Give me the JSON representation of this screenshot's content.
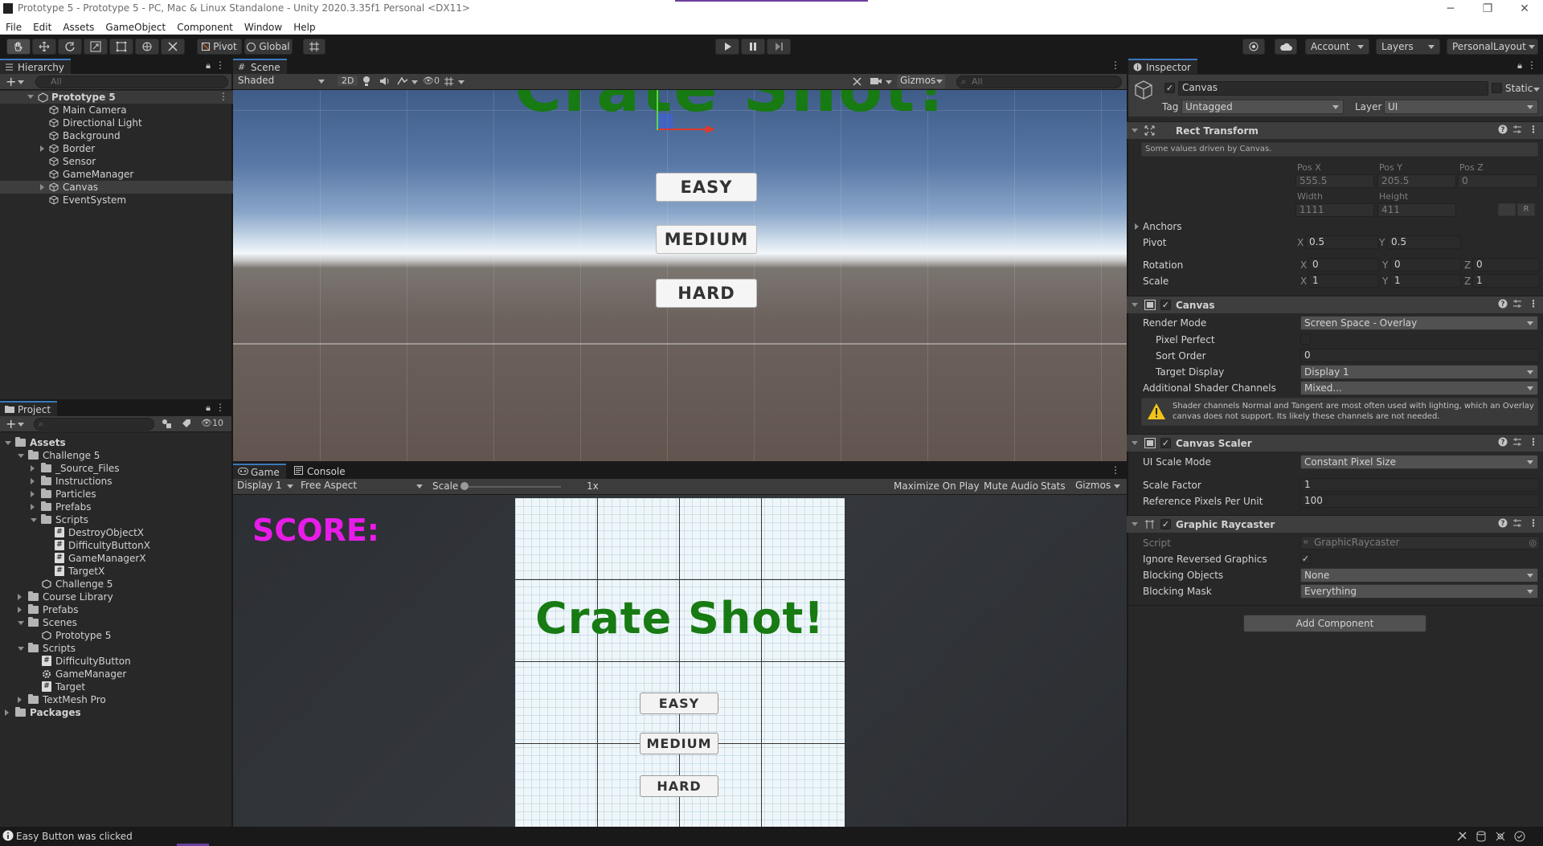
{
  "window": {
    "title": "Prototype 5 - Prototype 5 - PC, Mac & Linux Standalone - Unity 2020.3.35f1 Personal <DX11>",
    "minimize": "─",
    "restore": "❐",
    "close": "✕"
  },
  "menu": [
    "File",
    "Edit",
    "Assets",
    "GameObject",
    "Component",
    "Window",
    "Help"
  ],
  "toolbar": {
    "pivot": "Pivot",
    "global": "Global",
    "account": "Account",
    "layers": "Layers",
    "layout": "PersonalLayout"
  },
  "hierarchy": {
    "tab": "Hierarchy",
    "search_placeholder": "All",
    "scene": "Prototype 5",
    "items": [
      {
        "label": "Main Camera"
      },
      {
        "label": "Directional Light"
      },
      {
        "label": "Background"
      },
      {
        "label": "Border"
      },
      {
        "label": "Sensor"
      },
      {
        "label": "GameManager"
      },
      {
        "label": "Canvas"
      },
      {
        "label": "EventSystem"
      }
    ]
  },
  "project": {
    "tab": "Project",
    "count": "10",
    "items": [
      {
        "label": "Assets"
      },
      {
        "label": "Challenge 5"
      },
      {
        "label": "_Source_Files"
      },
      {
        "label": "Instructions"
      },
      {
        "label": "Particles"
      },
      {
        "label": "Prefabs"
      },
      {
        "label": "Scripts"
      },
      {
        "label": "DestroyObjectX"
      },
      {
        "label": "DifficultyButtonX"
      },
      {
        "label": "GameManagerX"
      },
      {
        "label": "TargetX"
      },
      {
        "label": "Challenge 5"
      },
      {
        "label": "Course Library"
      },
      {
        "label": "Prefabs"
      },
      {
        "label": "Scenes"
      },
      {
        "label": "Prototype 5"
      },
      {
        "label": "Scripts"
      },
      {
        "label": "DifficultyButton"
      },
      {
        "label": "GameManager"
      },
      {
        "label": "Target"
      },
      {
        "label": "TextMesh Pro"
      },
      {
        "label": "Packages"
      }
    ]
  },
  "scene": {
    "tab": "Scene",
    "shading": "Shaded",
    "mode2d": "2D",
    "hidden_count": "0",
    "gizmos": "Gizmos",
    "search_placeholder": "All",
    "title_text": "Crate Shot!",
    "buttons": [
      "EASY",
      "MEDIUM",
      "HARD"
    ]
  },
  "game": {
    "tab": "Game",
    "console_tab": "Console",
    "display": "Display 1",
    "aspect": "Free Aspect",
    "scale_label": "Scale",
    "scale_value": "1x",
    "maximize": "Maximize On Play",
    "mute": "Mute Audio",
    "stats": "Stats",
    "gizmos": "Gizmos",
    "score": "SCORE:",
    "title_text": "Crate Shot!",
    "buttons": [
      "EASY",
      "MEDIUM",
      "HARD"
    ]
  },
  "inspector": {
    "tab": "Inspector",
    "object_name": "Canvas",
    "static_label": "Static",
    "tag_label": "Tag",
    "tag_value": "Untagged",
    "layer_label": "Layer",
    "layer_value": "UI",
    "rect": {
      "title": "Rect Transform",
      "note": "Some values driven by Canvas.",
      "posx_label": "Pos X",
      "posy_label": "Pos Y",
      "posz_label": "Pos Z",
      "posx": "555.5",
      "posy": "205.5",
      "posz": "0",
      "width_label": "Width",
      "height_label": "Height",
      "width": "1111",
      "height": "411",
      "r_label": "R",
      "anchors": "Anchors",
      "pivot": "Pivot",
      "pivot_x": "0.5",
      "pivot_y": "0.5",
      "rotation": "Rotation",
      "rot_x": "0",
      "rot_y": "0",
      "rot_z": "0",
      "scale": "Scale",
      "scale_x": "1",
      "scale_y": "1",
      "scale_z": "1",
      "x": "X",
      "y": "Y",
      "z": "Z"
    },
    "canvas": {
      "title": "Canvas",
      "render_mode_label": "Render Mode",
      "render_mode": "Screen Space - Overlay",
      "pixel_perfect_label": "Pixel Perfect",
      "sort_order_label": "Sort Order",
      "sort_order": "0",
      "target_display_label": "Target Display",
      "target_display": "Display 1",
      "shader_channels_label": "Additional Shader Channels",
      "shader_channels": "Mixed...",
      "warning": "Shader channels Normal and Tangent are most often used with lighting, which an Overlay canvas does not support. Its likely these channels are not needed."
    },
    "scaler": {
      "title": "Canvas Scaler",
      "mode_label": "UI Scale Mode",
      "mode": "Constant Pixel Size",
      "factor_label": "Scale Factor",
      "factor": "1",
      "ppu_label": "Reference Pixels Per Unit",
      "ppu": "100"
    },
    "raycaster": {
      "title": "Graphic Raycaster",
      "script_label": "Script",
      "script": "GraphicRaycaster",
      "ignore_label": "Ignore Reversed Graphics",
      "blocking_label": "Blocking Objects",
      "blocking": "None",
      "mask_label": "Blocking Mask",
      "mask": "Everything"
    },
    "add_component": "Add Component"
  },
  "status": {
    "message": "Easy Button was clicked"
  },
  "colors": {
    "selection": "#2c5d87",
    "title_green": "#177a12",
    "score_magenta": "#e81ce8",
    "tab_accent": "#3a79bb"
  }
}
